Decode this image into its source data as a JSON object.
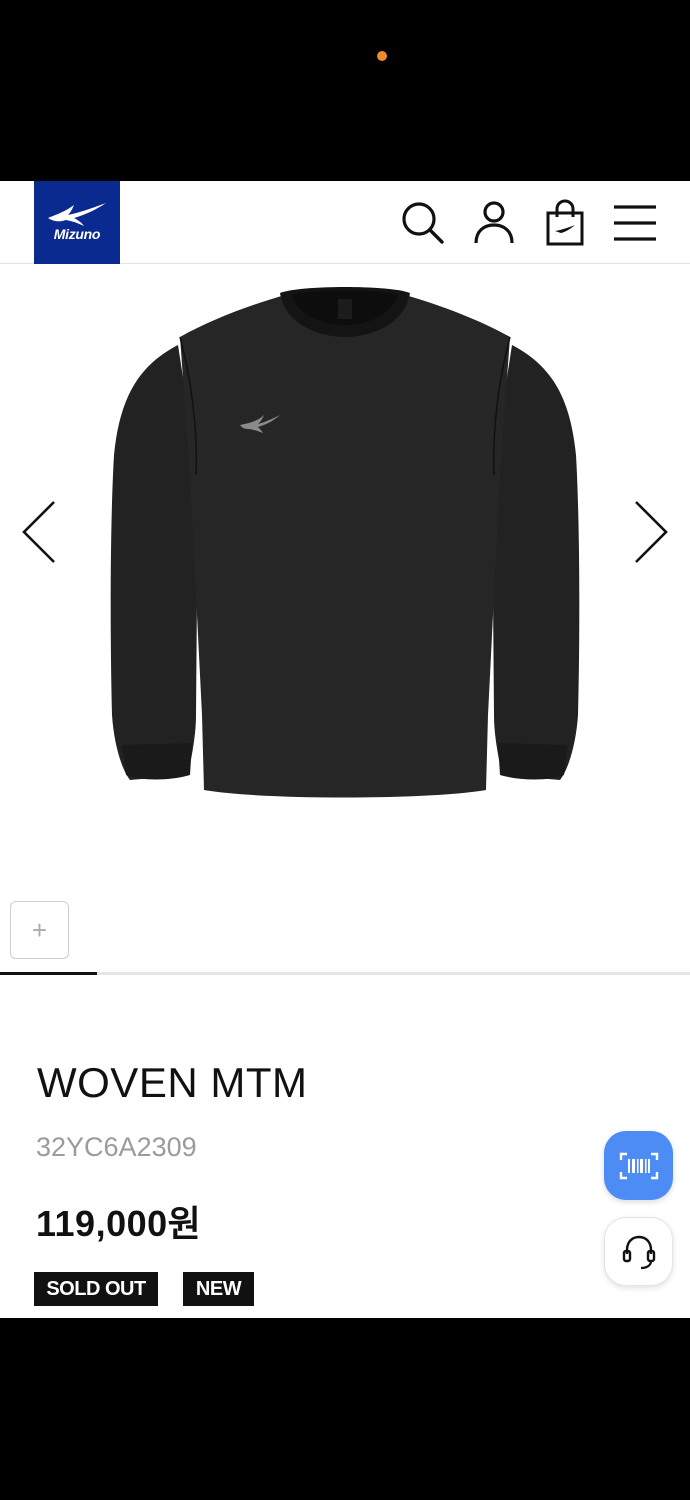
{
  "brand": {
    "logo_text": "Mizuno",
    "color": "#0b2a8f"
  },
  "header": {
    "icons": [
      "search-icon",
      "user-icon",
      "shopping-bag-icon",
      "menu-icon"
    ]
  },
  "gallery": {
    "add_thumb_label": "+",
    "prev_icon": "chevron-left-icon",
    "next_icon": "chevron-right-icon",
    "progress": 0.14
  },
  "product": {
    "name": "WOVEN MTM",
    "code": "32YC6A2309",
    "price": "119,000원",
    "badges": [
      "SOLD OUT",
      "NEW"
    ]
  },
  "floating": {
    "barcode_icon": "barcode-scan-icon",
    "support_icon": "headset-icon",
    "accent": "#4d8cf5"
  }
}
